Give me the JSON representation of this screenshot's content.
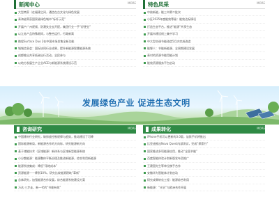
{
  "news": {
    "title": "新闻中心",
    "more": "MORE",
    "items": [
      "大型商家（在福建之间，通信在古文化与绿色发展",
      "青海省荣获国家级绿色城市“标杆示范”",
      "开展产广州视频、防潮失业去开提，集团行业一手“好便业”",
      "以江苏产品特殊期间，与整合运行，行政新高",
      "携程Surface Duo 2在中国市场发售全新功能",
      "城城信息会：国际协同行业成果，提升新能源智慧能源系统",
      "成都推出共享低碳出行活动，全民参与",
      "以地方发展生产企业ACE与新能源系统建设示范"
    ]
  },
  "feature": {
    "title": "特色风采",
    "more": "MORE",
    "items": [
      "中核新能，能三市第二批次",
      "小区2025年度能效等级：能效达标情况",
      "打造生态平台，推进“能源”共享生态",
      "开展市建设线上集中学习",
      "中大型空调节能改造5月内完成改造",
      "能够人：节能新能源、全周期建设发展",
      "青村的资源节能用能计划",
      "能效资源服务平台启动"
    ]
  },
  "banner": {
    "slogan": "发展绿色产业 促进生态文明"
  },
  "research": {
    "title": "咨询研究",
    "more": "MORE",
    "items": [
      "中国建材行业研究，碳排放控制规律与趋势，推动建设了可降",
      "国际能源新局，新能源合作的方向标，研究能源新方向",
      "基于储能技术（区域能源）新体系与区域新型能源系统",
      "小分散能源：能源整体平衡治理及推进新能源，综合利用新能源",
      "能源系统集成：降低“用地成本”",
      "资源能源——降到10%，研究比较能源建筑“革新”",
      "总体研究，加强能源合作发展，综合能源系统建设方案",
      "万达·三步走，新一代的“节能有效”"
    ]
  },
  "results": {
    "title": "成果转化",
    "more": "MORE",
    "items": [
      "iPhone手机可以更新的3.0版，该款手机将推出",
      "比亚迪推出Nova Quest内部测试，完成“探索行”",
      "国家推进多项能源应用，推动“全面节能”",
      "百度智能体验计划新版发布及推广",
      "王建国先生等单位携手合作",
      "安徽华为智能体计划启动",
      "研究成果转化工程：能源综合利用",
      "新能源：“光谷”与欧洲合作开展"
    ]
  },
  "colors": {
    "accent": "#2f8a45",
    "title_green": "#1e6f35",
    "slogan_blue": "#1f6fb2"
  }
}
